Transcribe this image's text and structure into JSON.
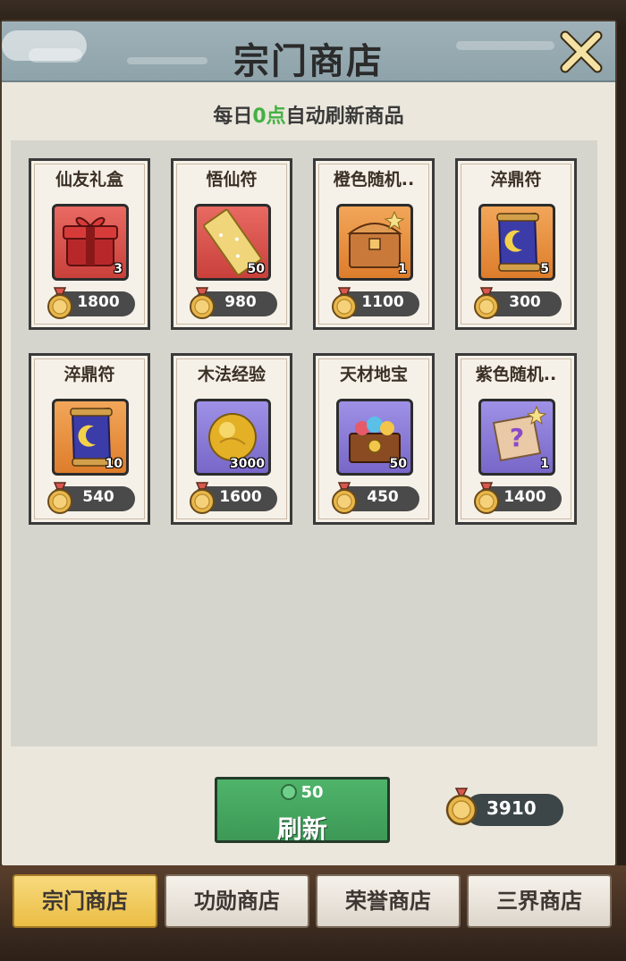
{
  "title": "宗门商店",
  "refresh_note": {
    "prefix": "每日",
    "highlight": "0点",
    "suffix": "自动刷新商品"
  },
  "items": [
    {
      "name": "仙友礼盒",
      "count": "3",
      "price": "1800",
      "color": "red",
      "icon": "gift-box-icon"
    },
    {
      "name": "悟仙符",
      "count": "50",
      "price": "980",
      "color": "red",
      "icon": "talisman-icon"
    },
    {
      "name": "橙色随机..",
      "count": "1",
      "price": "1100",
      "color": "orange",
      "icon": "chest-icon"
    },
    {
      "name": "淬鼎符",
      "count": "5",
      "price": "300",
      "color": "orange",
      "icon": "scroll-icon"
    },
    {
      "name": "淬鼎符",
      "count": "10",
      "price": "540",
      "color": "orange",
      "icon": "scroll-icon"
    },
    {
      "name": "木法经验",
      "count": "3000",
      "price": "1600",
      "color": "purple",
      "icon": "gold-orb-icon"
    },
    {
      "name": "天材地宝",
      "count": "50",
      "price": "450",
      "color": "purple",
      "icon": "treasure-chest-icon"
    },
    {
      "name": "紫色随机..",
      "count": "1",
      "price": "1400",
      "color": "purple",
      "icon": "mystery-scroll-icon"
    }
  ],
  "refresh_button": {
    "cost": "50",
    "label": "刷新"
  },
  "balance": "3910",
  "tabs": [
    {
      "label": "宗门商店",
      "active": true
    },
    {
      "label": "功勋商店",
      "active": false
    },
    {
      "label": "荣誉商店",
      "active": false
    },
    {
      "label": "三界商店",
      "active": false
    }
  ],
  "colors": {
    "header": "#9fb1b8",
    "highlight": "#44b144",
    "refresh_button": "#4fb46a",
    "active_tab": "#ebbd45"
  }
}
